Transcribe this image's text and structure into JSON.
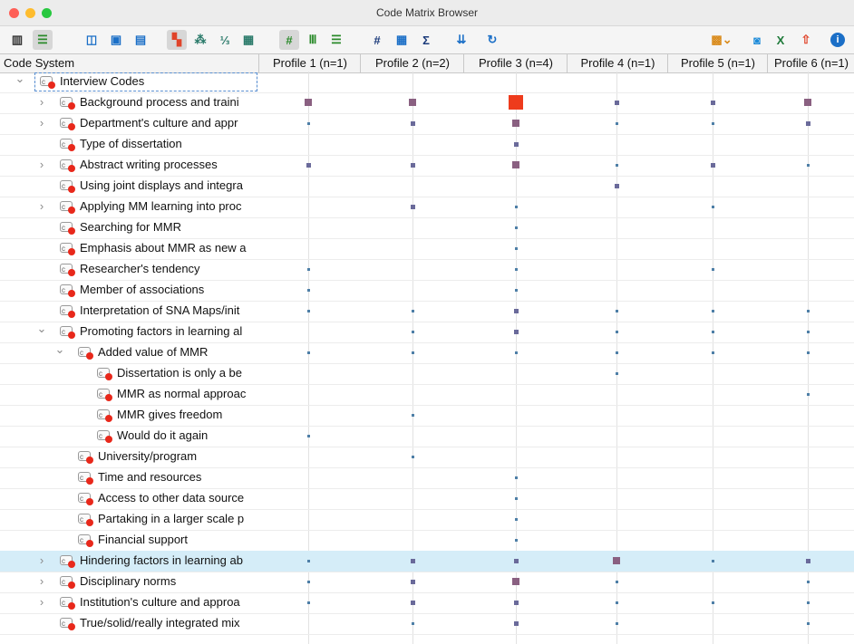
{
  "window": {
    "title": "Code Matrix Browser"
  },
  "colors": {
    "small": "#4e7fa7",
    "medium": "#6a6a9a",
    "large": "#8a6081",
    "largest": "#ee3b1c",
    "selected_row": "#d5edf8"
  },
  "toolbar": {
    "buttons": [
      {
        "name": "split-view-icon",
        "glyph": "▥",
        "color": "#333"
      },
      {
        "name": "code-list-icon",
        "glyph": "☰",
        "color": "#2a8a2a",
        "active": true
      },
      {
        "name": "layout-a-icon",
        "glyph": "◫",
        "color": "#1b6fc7"
      },
      {
        "name": "layout-b-icon",
        "glyph": "▣",
        "color": "#1b6fc7"
      },
      {
        "name": "layout-c-icon",
        "glyph": "▤",
        "color": "#1b6fc7"
      },
      {
        "name": "symbol-squares-icon",
        "glyph": "▚",
        "color": "#e0442a",
        "active": true
      },
      {
        "name": "symbol-circles-icon",
        "glyph": "⁂",
        "color": "#2a7a6a"
      },
      {
        "name": "symbol-numbers-icon",
        "glyph": "⅓",
        "color": "#2a7a6a"
      },
      {
        "name": "symbol-nums-colored-icon",
        "glyph": "▦",
        "color": "#2a7a6a"
      },
      {
        "name": "hash-table-icon",
        "glyph": "#",
        "color": "#2a8a2a",
        "active": true
      },
      {
        "name": "columns-icon",
        "glyph": "Ⅲ",
        "color": "#2a8a2a"
      },
      {
        "name": "rows-icon",
        "glyph": "☰",
        "color": "#2a8a2a"
      },
      {
        "name": "document-hash-icon",
        "glyph": "#",
        "color": "#1b3a7a"
      },
      {
        "name": "grid-stats-icon",
        "glyph": "▦",
        "color": "#1b6fc7"
      },
      {
        "name": "sum-icon",
        "glyph": "Σ",
        "color": "#1b3a7a"
      },
      {
        "name": "sort-icon",
        "glyph": "⇊",
        "color": "#1b6fc7"
      },
      {
        "name": "refresh-icon",
        "glyph": "↻",
        "color": "#1b6fc7"
      },
      {
        "name": "palette-dropdown-icon",
        "glyph": "▩⌄",
        "color": "#d98a1a"
      },
      {
        "name": "camera-icon",
        "glyph": "◙",
        "color": "#1b8ad9"
      },
      {
        "name": "excel-export-icon",
        "glyph": "X",
        "color": "#1f7a3a"
      },
      {
        "name": "export-icon",
        "glyph": "⇧",
        "color": "#e0442a"
      },
      {
        "name": "info-icon",
        "glyph": "i",
        "color": "#1b6fc7"
      }
    ]
  },
  "header": {
    "code_system": "Code System",
    "columns": [
      "Profile 1 (n=1)",
      "Profile 2 (n=2)",
      "Profile 3 (n=4)",
      "Profile 4 (n=1)",
      "Profile 5 (n=1)",
      "Profile 6 (n=1)"
    ]
  },
  "rows": [
    {
      "label": "Interview Codes",
      "level": 0,
      "arrow": "open",
      "cells": [
        0,
        0,
        0,
        0,
        0,
        0
      ]
    },
    {
      "label": "Background process and traini",
      "level": 1,
      "arrow": "closed",
      "cells": [
        3,
        3,
        4,
        2,
        2,
        3
      ]
    },
    {
      "label": "Department's culture and appr",
      "level": 1,
      "arrow": "closed",
      "cells": [
        1,
        2,
        3,
        1,
        1,
        2
      ]
    },
    {
      "label": "Type of dissertation",
      "level": 1,
      "arrow": "none",
      "cells": [
        0,
        0,
        2,
        0,
        0,
        0
      ]
    },
    {
      "label": "Abstract writing processes",
      "level": 1,
      "arrow": "closed",
      "cells": [
        2,
        2,
        3,
        1,
        2,
        1
      ]
    },
    {
      "label": "Using joint displays and integra",
      "level": 1,
      "arrow": "none",
      "cells": [
        0,
        0,
        0,
        2,
        0,
        0
      ]
    },
    {
      "label": "Applying MM learning into proc",
      "level": 1,
      "arrow": "closed",
      "cells": [
        0,
        2,
        1,
        0,
        1,
        0
      ]
    },
    {
      "label": "Searching for MMR",
      "level": 1,
      "arrow": "none",
      "cells": [
        0,
        0,
        1,
        0,
        0,
        0
      ]
    },
    {
      "label": "Emphasis about MMR as new a",
      "level": 1,
      "arrow": "none",
      "cells": [
        0,
        0,
        1,
        0,
        0,
        0
      ]
    },
    {
      "label": "Researcher's tendency",
      "level": 1,
      "arrow": "none",
      "cells": [
        1,
        0,
        1,
        0,
        1,
        0
      ]
    },
    {
      "label": "Member of associations",
      "level": 1,
      "arrow": "none",
      "cells": [
        1,
        0,
        1,
        0,
        0,
        0
      ]
    },
    {
      "label": "Interpretation of SNA Maps/init",
      "level": 1,
      "arrow": "none",
      "cells": [
        1,
        1,
        2,
        1,
        1,
        1
      ]
    },
    {
      "label": "Promoting factors in learning al",
      "level": 1,
      "arrow": "open",
      "cells": [
        0,
        1,
        2,
        1,
        1,
        1
      ]
    },
    {
      "label": "Added value of MMR",
      "level": 2,
      "arrow": "open",
      "cells": [
        1,
        1,
        1,
        1,
        1,
        1
      ]
    },
    {
      "label": "Dissertation is only a be",
      "level": 3,
      "arrow": "none",
      "cells": [
        0,
        0,
        0,
        1,
        0,
        0
      ]
    },
    {
      "label": "MMR as normal approac",
      "level": 3,
      "arrow": "none",
      "cells": [
        0,
        0,
        0,
        0,
        0,
        1
      ]
    },
    {
      "label": "MMR gives freedom",
      "level": 3,
      "arrow": "none",
      "cells": [
        0,
        1,
        0,
        0,
        0,
        0
      ]
    },
    {
      "label": "Would do it again",
      "level": 3,
      "arrow": "none",
      "cells": [
        1,
        0,
        0,
        0,
        0,
        0
      ]
    },
    {
      "label": "University/program",
      "level": 2,
      "arrow": "none",
      "cells": [
        0,
        1,
        0,
        0,
        0,
        0
      ]
    },
    {
      "label": "Time and resources",
      "level": 2,
      "arrow": "none",
      "cells": [
        0,
        0,
        1,
        0,
        0,
        0
      ]
    },
    {
      "label": "Access to other data source",
      "level": 2,
      "arrow": "none",
      "cells": [
        0,
        0,
        1,
        0,
        0,
        0
      ]
    },
    {
      "label": "Partaking in a larger scale p",
      "level": 2,
      "arrow": "none",
      "cells": [
        0,
        0,
        1,
        0,
        0,
        0
      ]
    },
    {
      "label": "Financial support",
      "level": 2,
      "arrow": "none",
      "cells": [
        0,
        0,
        1,
        0,
        0,
        0
      ]
    },
    {
      "label": "Hindering factors in learning ab",
      "level": 1,
      "arrow": "closed",
      "selected": true,
      "cells": [
        1,
        2,
        2,
        3,
        1,
        2
      ]
    },
    {
      "label": "Disciplinary norms",
      "level": 1,
      "arrow": "closed",
      "cells": [
        1,
        2,
        3,
        1,
        0,
        1
      ]
    },
    {
      "label": "Institution's culture and approa",
      "level": 1,
      "arrow": "closed",
      "cells": [
        1,
        2,
        2,
        1,
        1,
        1
      ]
    },
    {
      "label": "True/solid/really integrated mix",
      "level": 1,
      "arrow": "none",
      "cells": [
        0,
        1,
        2,
        1,
        0,
        1
      ]
    }
  ]
}
